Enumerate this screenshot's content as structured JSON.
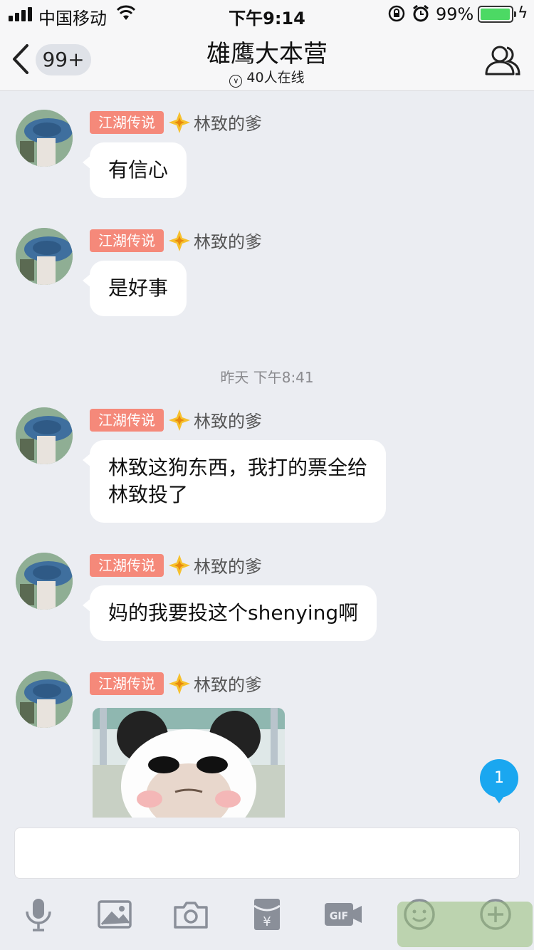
{
  "status_bar": {
    "carrier": "中国移动",
    "time": "下午9:14",
    "battery": "99%"
  },
  "nav": {
    "back_count": "99+",
    "title": "雄鹰大本营",
    "online": "40人在线"
  },
  "timestamp": "昨天 下午8:41",
  "messages": [
    {
      "tag": "江湖传说",
      "sender": "林致的爹",
      "text": "有信心"
    },
    {
      "tag": "江湖传说",
      "sender": "林致的爹",
      "text": "是好事"
    },
    {
      "tag": "江湖传说",
      "sender": "林致的爹",
      "text_line1": "林致这狗东西，我打的票全给",
      "text_line2": "林致投了"
    },
    {
      "tag": "江湖传说",
      "sender": "林致的爹",
      "text": "妈的我要投这个shenying啊"
    },
    {
      "tag": "江湖传说",
      "sender": "林致的爹"
    }
  ],
  "new_message_count": "1",
  "toolbar": {
    "gif_label": "GIF"
  },
  "colors": {
    "tag_bg": "#f5897a",
    "badge_blue": "#1aa7f0",
    "battery_green": "#4cd964"
  },
  "icons": [
    "signal-icon",
    "wifi-icon",
    "rotation-lock-icon",
    "alarm-icon",
    "battery-icon",
    "charging-icon",
    "back-chevron-icon",
    "members-icon",
    "rank-star-icon",
    "microphone-icon",
    "image-icon",
    "camera-icon",
    "red-packet-icon",
    "gif-icon",
    "emoji-icon",
    "plus-icon"
  ]
}
